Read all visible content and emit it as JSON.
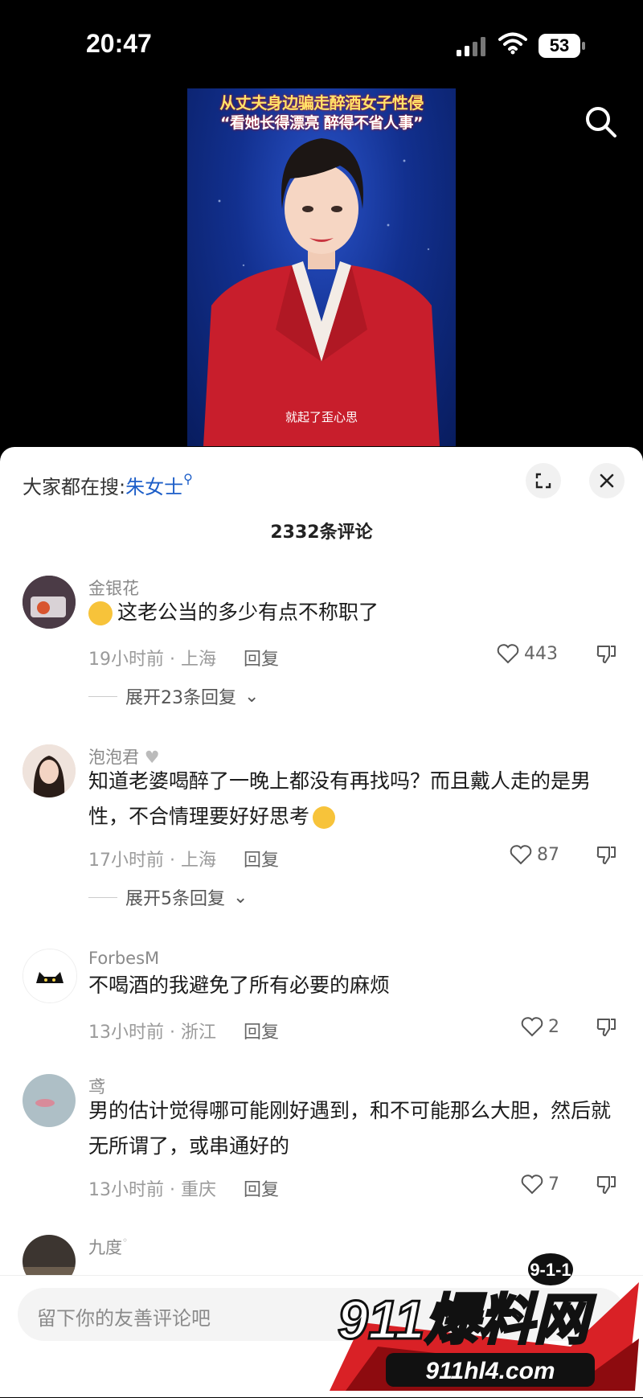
{
  "status_bar": {
    "time": "20:47",
    "battery": "53"
  },
  "video": {
    "title_line1": "从丈夫身边骗走醉酒女子性侵",
    "title_line2": "“看她长得漂亮 醉得不省人事”",
    "subtitle": "就起了歪心思"
  },
  "sheet": {
    "hot_search_label": "大家都在搜:",
    "hot_search_keyword": "朱女士",
    "comment_count": "2332条评论"
  },
  "comments": [
    {
      "user": "金银花",
      "text": "这老公当的多少有点不称职了",
      "time_loc": "19小时前 · 上海",
      "reply": "回复",
      "likes": "443",
      "expand": "展开23条回复"
    },
    {
      "user": "泡泡君",
      "text": "知道老婆喝醉了一晚上都没有再找吗？而且戴人走的是男性，不合情理要好好思考",
      "time_loc": "17小时前 · 上海",
      "reply": "回复",
      "likes": "87",
      "expand": "展开5条回复"
    },
    {
      "user": "ForbesM",
      "text": "不喝酒的我避免了所有必要的麻烦",
      "time_loc": "13小时前 · 浙江",
      "reply": "回复",
      "likes": "2"
    },
    {
      "user": "鸢",
      "text": "男的估计觉得哪可能刚好遇到，和不可能那么大胆，然后就无所谓了，或串通好的",
      "time_loc": "13小时前 · 重庆",
      "reply": "回复",
      "likes": "7"
    },
    {
      "user": "九度"
    }
  ],
  "input": {
    "placeholder": "留下你的友善评论吧"
  },
  "watermark": {
    "badge": "9-1-1",
    "brand": "911爆料网",
    "url": "911hl4.com"
  }
}
